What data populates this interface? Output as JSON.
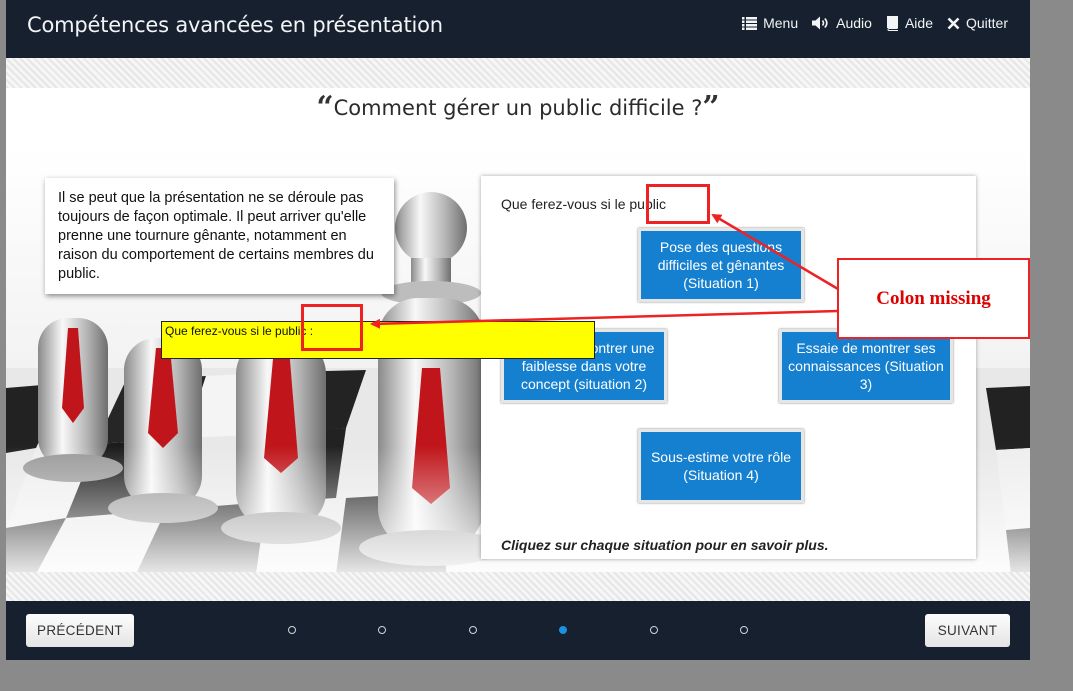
{
  "header": {
    "title": "Compétences avancées en présentation",
    "menu": [
      {
        "label": "Menu",
        "icon": "list-icon"
      },
      {
        "label": "Audio",
        "icon": "speaker-icon"
      },
      {
        "label": "Aide",
        "icon": "book-icon"
      },
      {
        "label": "Quitter",
        "icon": "close-icon"
      }
    ]
  },
  "slide": {
    "open_quote": "“",
    "heading": "Comment gérer un public difficile ?",
    "close_quote": "”",
    "intro": "Il se peut que la présentation ne se déroule pas toujours de façon optimale. Il peut arriver qu'elle prenne une tournure gênante, notamment en raison du comportement de certains membres du public.",
    "prompt": "Que ferez-vous si le public",
    "situations": [
      "Pose des questions difficiles et gênantes (Situation 1)",
      "Essaie de montrer une faiblesse dans votre concept (situation 2)",
      "Essaie de montrer ses connaissances (Situation 3)",
      "Sous-estime votre rôle (Situation 4)"
    ],
    "instruction": "Cliquez sur chaque situation pour en savoir plus."
  },
  "annotation": {
    "corrected_text": "Que ferez-vous si le public :",
    "note": "Colon missing"
  },
  "footer": {
    "prev_label": "PRÉCÉDENT",
    "next_label": "SUIVANT",
    "page_count": 6,
    "current_page": 4
  },
  "colors": {
    "bar": "#17202e",
    "button_blue": "#1680d0",
    "annotation_red": "#e22222",
    "highlight_yellow": "#ffff00",
    "active_dot": "#1b8fe0"
  }
}
